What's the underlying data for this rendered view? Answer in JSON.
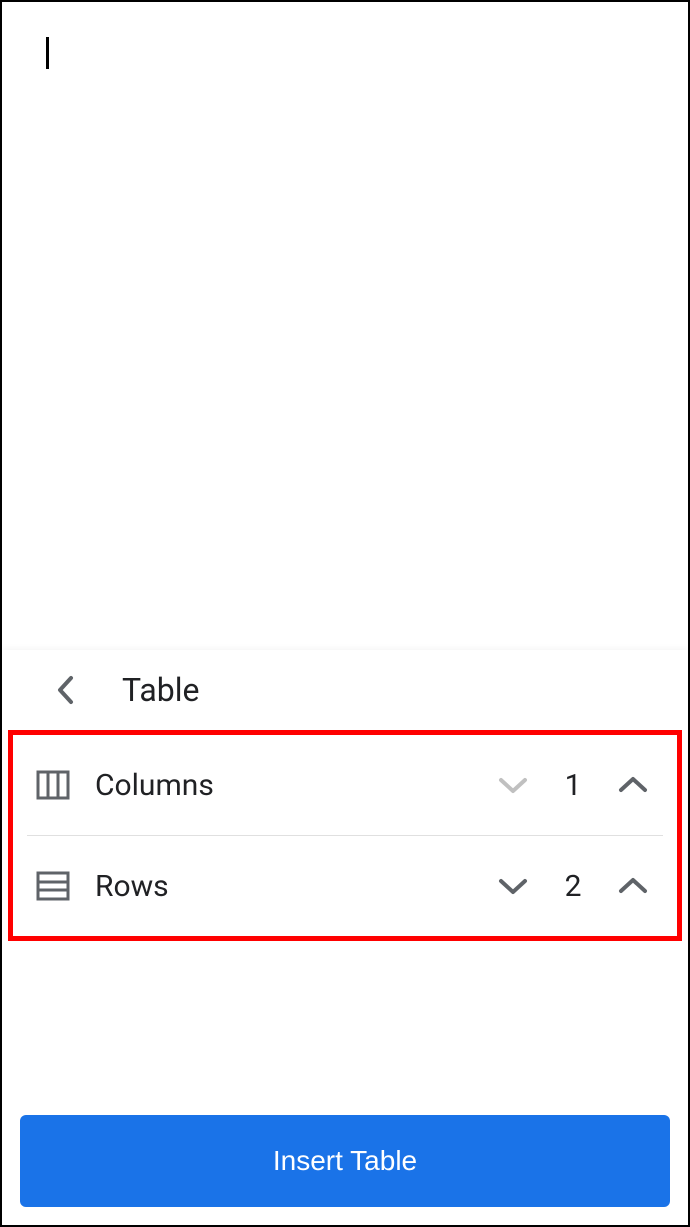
{
  "panel": {
    "title": "Table",
    "columns": {
      "label": "Columns",
      "value": "1"
    },
    "rows": {
      "label": "Rows",
      "value": "2"
    },
    "insert_label": "Insert Table"
  }
}
